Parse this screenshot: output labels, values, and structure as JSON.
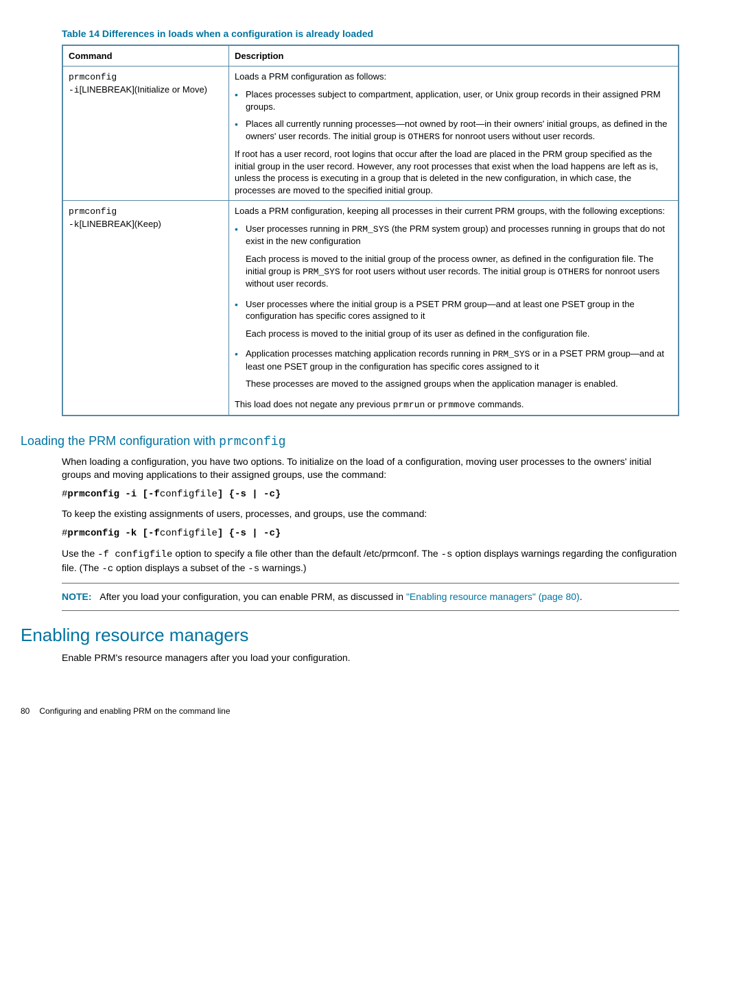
{
  "table": {
    "caption": "Table 14 Differences in loads when a configuration is already loaded",
    "headers": {
      "c1": "Command",
      "c2": "Description"
    },
    "row1": {
      "cmd_l1": "prmconfig",
      "cmd_l2": "-i",
      "cmd_l3": "[LINEBREAK](Initialize or Move)",
      "lead": "Loads a PRM configuration as follows:",
      "b1a": "Places processes subject to compartment, application, user, or Unix group records in their assigned PRM groups.",
      "b2a": "Places all currently running processes—not owned by root—in their owners' initial groups, as defined in the owners' user records. The initial group is ",
      "b2code": "OTHERS",
      "b2b": " for nonroot users without user records.",
      "para": "If root has a user record, root logins that occur after the load are placed in the PRM group specified as the initial group in the user record. However, any root processes that exist when the load happens are left as is, unless the process is executing in a group that is deleted in the new configuration, in which case, the processes are moved to the specified initial group."
    },
    "row2": {
      "cmd_l1": "prmconfig",
      "cmd_l2": "-k",
      "cmd_l3": "[LINEBREAK](Keep)",
      "lead": "Loads a PRM configuration, keeping all processes in their current PRM groups, with the following exceptions:",
      "b1a": "User processes running in ",
      "b1code": "PRM_SYS",
      "b1b": " (the PRM system group) and processes running in groups that do not exist in the new configuration",
      "sub1a": "Each process is moved to the initial group of the process owner, as defined in the configuration file. The initial group is ",
      "sub1code1": "PRM_SYS",
      "sub1b": " for root users without user records. The initial group is ",
      "sub1code2": "OTHERS",
      "sub1c": " for nonroot users without user records.",
      "b2": "User processes where the initial group is a PSET PRM group—and at least one PSET group in the configuration has specific cores assigned to it",
      "sub2": "Each process is moved to the initial group of its user as defined in the configuration file.",
      "b3a": "Application processes matching application records running in ",
      "b3code": "PRM_SYS",
      "b3b": " or in a PSET PRM group—and at least one PSET group in the configuration has specific cores assigned to it",
      "sub3": "These processes are moved to the assigned groups when the application manager is enabled.",
      "tail_a": "This load does not negate any previous ",
      "tail_code1": "prmrun",
      "tail_b": " or ",
      "tail_code2": "prmmove",
      "tail_c": " commands."
    }
  },
  "sec1": {
    "title_a": "Loading the PRM configuration with ",
    "title_code": "prmconfig",
    "p1": "When loading a configuration, you have two options. To initialize on the load of a configuration, moving user processes to the owners' initial groups and moving applications to their assigned groups, use the command:",
    "cmd1_a": "#",
    "cmd1_b": "prmconfig -i [-f",
    "cmd1_c": "configfile",
    "cmd1_d": "] {-s | -c}",
    "p2": "To keep the existing assignments of users, processes, and groups, use the command:",
    "cmd2_a": "#",
    "cmd2_b": "prmconfig -k [-f",
    "cmd2_c": "configfile",
    "cmd2_d": "] {-s | -c}",
    "p3a": "Use the ",
    "p3code1": "-f configfile",
    "p3b": " option to specify a file other than the default /etc/prmconf. The ",
    "p3code2": "-s",
    "p3c": " option displays warnings regarding the configuration file. (The ",
    "p3code3": "-c",
    "p3d": " option displays a subset of the ",
    "p3code4": "-s",
    "p3e": " warnings.)",
    "note_label": "NOTE:",
    "note_a": "After you load your configuration, you can enable PRM, as discussed in ",
    "note_link": "\"Enabling resource managers\" (page 80)",
    "note_b": "."
  },
  "sec2": {
    "title": "Enabling resource managers",
    "p1": "Enable PRM's resource managers after you load your configuration."
  },
  "footer": {
    "page": "80",
    "text": "Configuring and enabling PRM on the command line"
  }
}
